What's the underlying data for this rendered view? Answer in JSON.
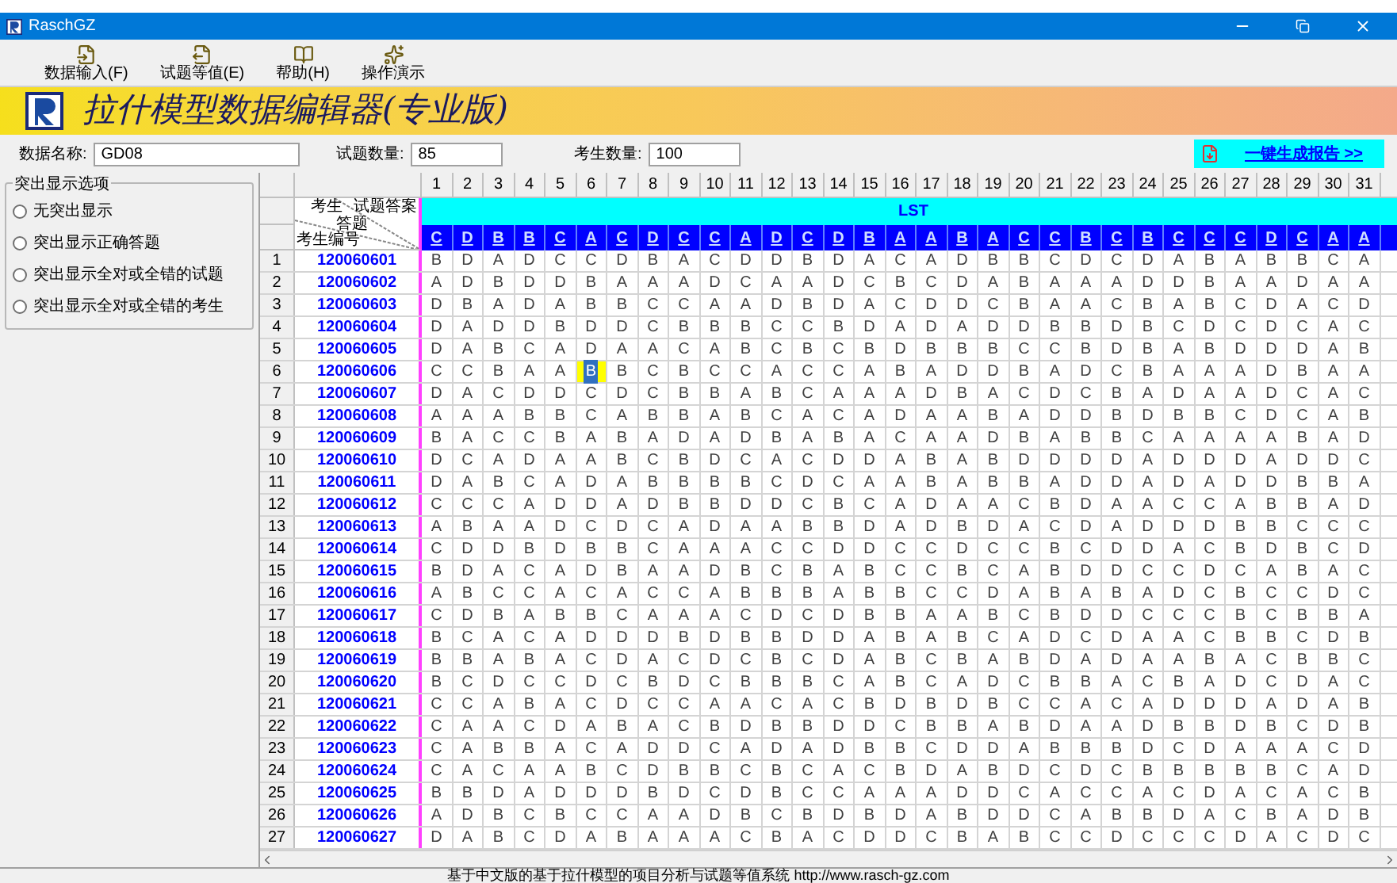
{
  "window": {
    "title": "RaschGZ"
  },
  "toolbar": [
    {
      "label": "数据输入(F)"
    },
    {
      "label": "试题等值(E)"
    },
    {
      "label": "帮助(H)"
    },
    {
      "label": "操作演示"
    }
  ],
  "banner": {
    "title": "拉什模型数据编辑器(专业版)"
  },
  "fields": [
    {
      "label": "数据名称:",
      "value": "GD08"
    },
    {
      "label": "试题数量:",
      "value": "85"
    },
    {
      "label": "考生数量:",
      "value": "100"
    }
  ],
  "report_button": {
    "label": "一键生成报告 >>"
  },
  "highlight_options": {
    "title": "突出显示选项",
    "options": [
      {
        "label": "无突出显示",
        "selected": false
      },
      {
        "label": "突出显示正确答题",
        "selected": false
      },
      {
        "label": "突出显示全对或全错的试题",
        "selected": false
      },
      {
        "label": "突出显示全对或全错的考生",
        "selected": false
      }
    ]
  },
  "grid": {
    "corner_labels": [
      "考生",
      "试题答案",
      "答题",
      "考生编号"
    ],
    "item_numbers": [
      "1",
      "2",
      "3",
      "4",
      "5",
      "6",
      "7",
      "8",
      "9",
      "10",
      "11",
      "12",
      "13",
      "14",
      "15",
      "16",
      "17",
      "18",
      "19",
      "20",
      "21",
      "22",
      "23",
      "24",
      "25",
      "26",
      "27",
      "28",
      "29",
      "30",
      "31"
    ],
    "group_label": "LST",
    "answer_key": [
      "C",
      "D",
      "B",
      "B",
      "C",
      "A",
      "C",
      "D",
      "C",
      "C",
      "A",
      "D",
      "C",
      "D",
      "B",
      "A",
      "A",
      "B",
      "A",
      "C",
      "C",
      "B",
      "C",
      "B",
      "C",
      "C",
      "C",
      "D",
      "C",
      "A",
      "A"
    ],
    "rows": [
      {
        "no": "1",
        "id": "120060601",
        "answers": [
          "B",
          "D",
          "A",
          "D",
          "C",
          "C",
          "D",
          "B",
          "A",
          "C",
          "D",
          "D",
          "B",
          "D",
          "A",
          "C",
          "A",
          "D",
          "B",
          "B",
          "C",
          "D",
          "C",
          "D",
          "A",
          "B",
          "A",
          "B",
          "B",
          "C",
          "A"
        ]
      },
      {
        "no": "2",
        "id": "120060602",
        "answers": [
          "A",
          "D",
          "B",
          "D",
          "D",
          "B",
          "A",
          "A",
          "A",
          "D",
          "C",
          "A",
          "A",
          "D",
          "C",
          "B",
          "C",
          "D",
          "A",
          "B",
          "A",
          "A",
          "A",
          "D",
          "D",
          "B",
          "A",
          "A",
          "D",
          "A",
          "A"
        ]
      },
      {
        "no": "3",
        "id": "120060603",
        "answers": [
          "D",
          "B",
          "A",
          "D",
          "A",
          "B",
          "B",
          "C",
          "C",
          "A",
          "A",
          "D",
          "B",
          "D",
          "A",
          "C",
          "D",
          "D",
          "C",
          "B",
          "A",
          "A",
          "C",
          "B",
          "A",
          "B",
          "C",
          "D",
          "A",
          "C",
          "D"
        ]
      },
      {
        "no": "4",
        "id": "120060604",
        "answers": [
          "D",
          "A",
          "D",
          "D",
          "B",
          "D",
          "D",
          "C",
          "B",
          "B",
          "B",
          "C",
          "C",
          "B",
          "D",
          "A",
          "D",
          "A",
          "D",
          "D",
          "B",
          "B",
          "D",
          "B",
          "C",
          "D",
          "C",
          "D",
          "C",
          "A",
          "C"
        ]
      },
      {
        "no": "5",
        "id": "120060605",
        "answers": [
          "D",
          "A",
          "B",
          "C",
          "A",
          "D",
          "A",
          "A",
          "C",
          "A",
          "B",
          "C",
          "B",
          "C",
          "B",
          "D",
          "B",
          "B",
          "B",
          "C",
          "C",
          "B",
          "D",
          "B",
          "A",
          "B",
          "D",
          "D",
          "D",
          "A",
          "B"
        ]
      },
      {
        "no": "6",
        "id": "120060606",
        "answers": [
          "C",
          "C",
          "B",
          "A",
          "A",
          {
            "value": "B",
            "selected": true
          },
          "B",
          "C",
          "B",
          "C",
          "C",
          "A",
          "C",
          "C",
          "A",
          "B",
          "A",
          "D",
          "D",
          "B",
          "A",
          "D",
          "C",
          "B",
          "A",
          "A",
          "A",
          "D",
          "B",
          "A",
          "A"
        ]
      },
      {
        "no": "7",
        "id": "120060607",
        "answers": [
          "D",
          "A",
          "C",
          "D",
          "D",
          "C",
          "D",
          "C",
          "B",
          "B",
          "A",
          "B",
          "C",
          "A",
          "A",
          "A",
          "D",
          "B",
          "A",
          "C",
          "D",
          "C",
          "B",
          "A",
          "D",
          "A",
          "A",
          "D",
          "C",
          "A",
          "C"
        ]
      },
      {
        "no": "8",
        "id": "120060608",
        "answers": [
          "A",
          "A",
          "A",
          "B",
          "B",
          "C",
          "A",
          "B",
          "B",
          "A",
          "B",
          "C",
          "A",
          "C",
          "A",
          "D",
          "A",
          "A",
          "B",
          "A",
          "D",
          "D",
          "B",
          "D",
          "B",
          "B",
          "C",
          "D",
          "C",
          "A",
          "B"
        ]
      },
      {
        "no": "9",
        "id": "120060609",
        "answers": [
          "B",
          "A",
          "C",
          "C",
          "B",
          "A",
          "B",
          "A",
          "D",
          "A",
          "D",
          "B",
          "A",
          "B",
          "A",
          "C",
          "A",
          "A",
          "D",
          "B",
          "A",
          "B",
          "B",
          "C",
          "A",
          "A",
          "A",
          "A",
          "B",
          "A",
          "D"
        ]
      },
      {
        "no": "10",
        "id": "120060610",
        "answers": [
          "D",
          "C",
          "A",
          "D",
          "A",
          "A",
          "B",
          "C",
          "B",
          "D",
          "C",
          "A",
          "C",
          "D",
          "D",
          "A",
          "B",
          "A",
          "B",
          "D",
          "D",
          "D",
          "D",
          "A",
          "D",
          "D",
          "D",
          "A",
          "D",
          "D",
          "C"
        ]
      },
      {
        "no": "11",
        "id": "120060611",
        "answers": [
          "D",
          "A",
          "B",
          "C",
          "A",
          "D",
          "A",
          "B",
          "B",
          "B",
          "B",
          "C",
          "D",
          "C",
          "A",
          "A",
          "B",
          "A",
          "B",
          "B",
          "A",
          "D",
          "D",
          "A",
          "D",
          "A",
          "D",
          "D",
          "B",
          "B",
          "A"
        ]
      },
      {
        "no": "12",
        "id": "120060612",
        "answers": [
          "C",
          "C",
          "C",
          "A",
          "D",
          "D",
          "A",
          "D",
          "B",
          "B",
          "D",
          "D",
          "C",
          "B",
          "C",
          "A",
          "D",
          "A",
          "A",
          "C",
          "B",
          "D",
          "A",
          "A",
          "C",
          "C",
          "A",
          "B",
          "B",
          "A",
          "D"
        ]
      },
      {
        "no": "13",
        "id": "120060613",
        "answers": [
          "A",
          "B",
          "A",
          "A",
          "D",
          "C",
          "D",
          "C",
          "A",
          "D",
          "A",
          "A",
          "B",
          "B",
          "D",
          "A",
          "D",
          "B",
          "D",
          "A",
          "C",
          "D",
          "A",
          "D",
          "D",
          "D",
          "B",
          "B",
          "C",
          "C",
          "C"
        ]
      },
      {
        "no": "14",
        "id": "120060614",
        "answers": [
          "C",
          "D",
          "D",
          "B",
          "D",
          "B",
          "B",
          "C",
          "A",
          "A",
          "A",
          "C",
          "C",
          "D",
          "D",
          "C",
          "C",
          "D",
          "C",
          "C",
          "B",
          "C",
          "D",
          "D",
          "A",
          "C",
          "B",
          "D",
          "B",
          "C",
          "D"
        ]
      },
      {
        "no": "15",
        "id": "120060615",
        "answers": [
          "B",
          "D",
          "A",
          "C",
          "A",
          "D",
          "B",
          "A",
          "A",
          "D",
          "B",
          "C",
          "B",
          "A",
          "B",
          "C",
          "C",
          "B",
          "C",
          "A",
          "B",
          "D",
          "D",
          "C",
          "C",
          "D",
          "C",
          "A",
          "B",
          "A",
          "C"
        ]
      },
      {
        "no": "16",
        "id": "120060616",
        "answers": [
          "A",
          "B",
          "C",
          "C",
          "A",
          "C",
          "A",
          "C",
          "C",
          "A",
          "B",
          "B",
          "B",
          "A",
          "B",
          "B",
          "C",
          "C",
          "D",
          "A",
          "B",
          "A",
          "B",
          "A",
          "D",
          "C",
          "B",
          "C",
          "C",
          "D",
          "C"
        ]
      },
      {
        "no": "17",
        "id": "120060617",
        "answers": [
          "C",
          "D",
          "B",
          "A",
          "B",
          "B",
          "C",
          "A",
          "A",
          "A",
          "C",
          "D",
          "C",
          "D",
          "B",
          "B",
          "A",
          "A",
          "B",
          "C",
          "B",
          "D",
          "D",
          "C",
          "C",
          "C",
          "B",
          "C",
          "B",
          "B",
          "A"
        ]
      },
      {
        "no": "18",
        "id": "120060618",
        "answers": [
          "B",
          "C",
          "A",
          "C",
          "A",
          "D",
          "D",
          "D",
          "B",
          "D",
          "B",
          "B",
          "D",
          "D",
          "A",
          "B",
          "A",
          "B",
          "C",
          "A",
          "D",
          "C",
          "D",
          "A",
          "A",
          "C",
          "B",
          "B",
          "C",
          "D",
          "B"
        ]
      },
      {
        "no": "19",
        "id": "120060619",
        "answers": [
          "B",
          "B",
          "A",
          "B",
          "A",
          "C",
          "D",
          "A",
          "C",
          "D",
          "C",
          "B",
          "C",
          "D",
          "A",
          "B",
          "C",
          "B",
          "A",
          "B",
          "D",
          "A",
          "D",
          "A",
          "A",
          "B",
          "A",
          "C",
          "B",
          "B",
          "C"
        ]
      },
      {
        "no": "20",
        "id": "120060620",
        "answers": [
          "B",
          "C",
          "D",
          "C",
          "C",
          "D",
          "C",
          "B",
          "D",
          "C",
          "B",
          "B",
          "B",
          "C",
          "A",
          "B",
          "C",
          "A",
          "D",
          "C",
          "B",
          "B",
          "A",
          "C",
          "B",
          "A",
          "D",
          "C",
          "D",
          "A",
          "C"
        ]
      },
      {
        "no": "21",
        "id": "120060621",
        "answers": [
          "C",
          "C",
          "A",
          "B",
          "A",
          "C",
          "D",
          "C",
          "C",
          "A",
          "A",
          "C",
          "A",
          "C",
          "B",
          "D",
          "B",
          "D",
          "B",
          "C",
          "C",
          "A",
          "C",
          "A",
          "D",
          "D",
          "D",
          "A",
          "D",
          "A",
          "B"
        ]
      },
      {
        "no": "22",
        "id": "120060622",
        "answers": [
          "C",
          "A",
          "A",
          "C",
          "D",
          "A",
          "B",
          "A",
          "C",
          "B",
          "D",
          "B",
          "B",
          "D",
          "D",
          "C",
          "B",
          "B",
          "A",
          "B",
          "D",
          "A",
          "A",
          "D",
          "B",
          "B",
          "D",
          "B",
          "C",
          "D",
          "B"
        ]
      },
      {
        "no": "23",
        "id": "120060623",
        "answers": [
          "C",
          "A",
          "B",
          "B",
          "A",
          "C",
          "A",
          "D",
          "D",
          "C",
          "A",
          "D",
          "A",
          "D",
          "B",
          "B",
          "C",
          "D",
          "D",
          "A",
          "B",
          "B",
          "B",
          "D",
          "C",
          "D",
          "A",
          "A",
          "A",
          "C",
          "D"
        ]
      },
      {
        "no": "24",
        "id": "120060624",
        "answers": [
          "C",
          "A",
          "C",
          "A",
          "A",
          "B",
          "C",
          "D",
          "B",
          "B",
          "C",
          "B",
          "C",
          "A",
          "C",
          "B",
          "D",
          "A",
          "B",
          "D",
          "C",
          "D",
          "C",
          "B",
          "B",
          "B",
          "B",
          "B",
          "C",
          "A",
          "D"
        ]
      },
      {
        "no": "25",
        "id": "120060625",
        "answers": [
          "B",
          "B",
          "D",
          "A",
          "D",
          "D",
          "D",
          "B",
          "D",
          "C",
          "D",
          "B",
          "C",
          "C",
          "A",
          "A",
          "A",
          "D",
          "D",
          "C",
          "A",
          "C",
          "C",
          "A",
          "C",
          "D",
          "A",
          "C",
          "A",
          "C",
          "B"
        ]
      },
      {
        "no": "26",
        "id": "120060626",
        "answers": [
          "A",
          "D",
          "B",
          "C",
          "B",
          "C",
          "C",
          "A",
          "A",
          "D",
          "B",
          "C",
          "B",
          "D",
          "B",
          "D",
          "A",
          "B",
          "D",
          "D",
          "C",
          "A",
          "B",
          "B",
          "D",
          "A",
          "C",
          "B",
          "A",
          "D",
          "B"
        ]
      },
      {
        "no": "27",
        "id": "120060627",
        "answers": [
          "D",
          "A",
          "B",
          "C",
          "D",
          "A",
          "B",
          "A",
          "A",
          "A",
          "C",
          "B",
          "A",
          "C",
          "D",
          "D",
          "C",
          "B",
          "A",
          "B",
          "C",
          "C",
          "D",
          "C",
          "C",
          "C",
          "D",
          "A",
          "C",
          "D",
          "C"
        ]
      }
    ]
  },
  "status_bar": {
    "text": "基于中文版的基于拉什模型的项目分析与试题等值系统 http://www.rasch-gz.com"
  }
}
